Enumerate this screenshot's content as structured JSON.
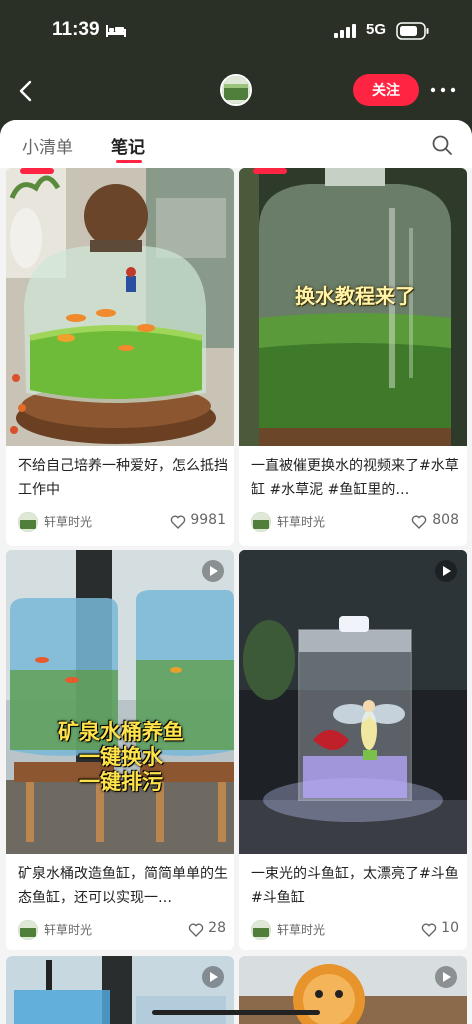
{
  "status": {
    "time": "11:39",
    "network": "5G"
  },
  "nav": {
    "follow_label": "关注"
  },
  "tabs": [
    {
      "label": "小清单"
    },
    {
      "label": "笔记"
    }
  ],
  "cards": [
    {
      "title": "不给自己培养一种爱好，怎么抵挡工作中",
      "author": "轩草时光",
      "likes": "9981",
      "has_play": false
    },
    {
      "title": "一直被催更换水的视频来了#水草缸 #水草泥 #鱼缸里的…",
      "author": "轩草时光",
      "likes": "808",
      "overlay": "换水教程来了",
      "has_play": false
    },
    {
      "title": "矿泉水桶改造鱼缸，简简单单的生态鱼缸，还可以实现一…",
      "author": "轩草时光",
      "likes": "28",
      "overlay_lines": [
        "矿泉水桶养鱼",
        "一键换水",
        "一键排污"
      ],
      "has_play": true
    },
    {
      "title": "一束光的斗鱼缸，太漂亮了#斗鱼 #斗鱼缸",
      "author": "轩草时光",
      "likes": "10",
      "has_play": true
    }
  ],
  "icons": {
    "back": "chevron-left-icon",
    "more": "more-dots-icon",
    "search": "search-icon",
    "like": "heart-outline-icon",
    "play": "play-icon"
  },
  "colors": {
    "accent": "#ff2442",
    "header_bg": "#2b3026",
    "sheet_bg": "#f4f4f4"
  }
}
